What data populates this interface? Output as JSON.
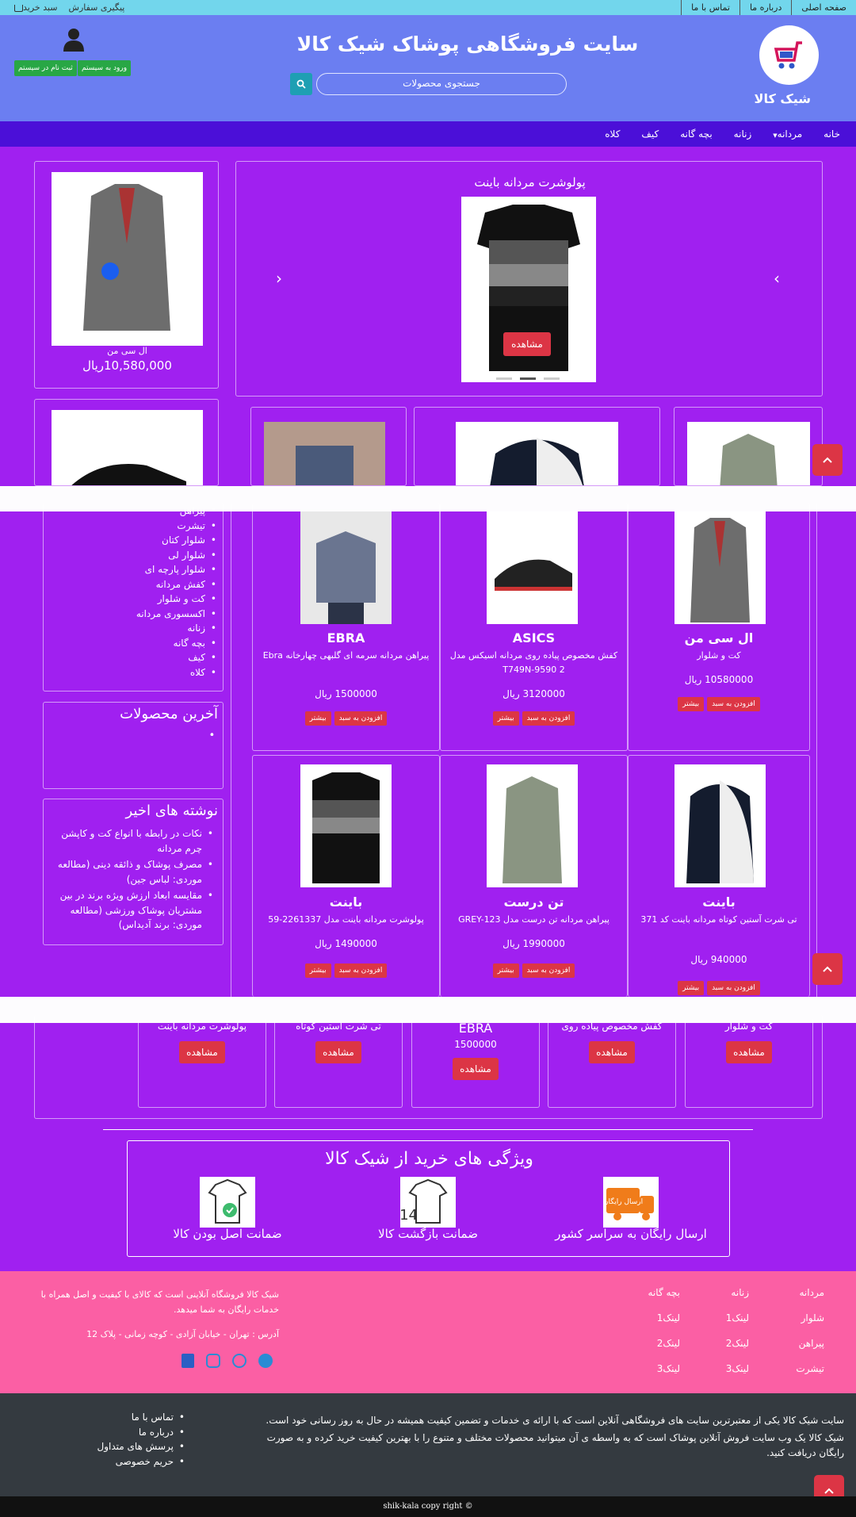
{
  "topbar": {
    "links": [
      "صفحه اصلی",
      "درباره ما",
      "تماس با ما"
    ],
    "track": "پیگیری سفارش",
    "cart": "سبد خرید"
  },
  "header": {
    "logo_text": "شیک کالا",
    "site_title": "سایت فروشگاهی پوشاک شیک کالا",
    "search_placeholder": "جستجوی محصولات",
    "login": "ورود به سیستم",
    "register": "ثبت نام در سیستم"
  },
  "nav": [
    "خانه",
    "مردانه",
    "زنانه",
    "بچه گانه",
    "کیف",
    "کلاه"
  ],
  "slider": {
    "title": "پولوشرت مردانه باینت",
    "button": "مشاهده"
  },
  "featured": {
    "name": "ال سی من",
    "price": "10,580,000ریال"
  },
  "categories": [
    "پیراهن",
    "تیشرت",
    "شلوار کتان",
    "شلوار لی",
    "شلوار پارچه ای",
    "کفش مردانه",
    "کت و شلوار",
    "اکسسوری مردانه",
    "زنانه",
    "بچه گانه",
    "کیف",
    "کلاه"
  ],
  "latest": {
    "title": "آخرین محصولات"
  },
  "posts": {
    "title": "نوشته های اخیر",
    "items": [
      "نکات در رابطه با انواع کت و کاپشن چرم مردانه",
      "مصرف پوشاک و ذائقه دینی (مطالعه موردی: لباس جین)",
      "مقایسه ابعاد ارزش ویژه برند در بین مشتریان پوشاک ورزشی (مطالعه موردی: برند آدیداس)"
    ]
  },
  "products": [
    {
      "brand": "ال سی من",
      "desc": "کت و شلوار",
      "price": "10580000 ریال"
    },
    {
      "brand": "ASICS",
      "desc": "کفش مخصوص پیاده روی مردانه اسیکس مدل T749N-9590 2",
      "price": "3120000 ریال"
    },
    {
      "brand": "EBRA",
      "desc": "پیراهن مردانه سرمه ای گلبهی چهارخانه Ebra",
      "price": "1500000 ریال"
    },
    {
      "brand": "باینت",
      "desc": "تی شرت آستین کوتاه مردانه باینت کد 371",
      "price": "940000 ریال"
    },
    {
      "brand": "تن درست",
      "desc": "پیراهن مردانه تن درست مدل GREY-123",
      "price": "1990000 ریال"
    },
    {
      "brand": "باینت",
      "desc": "پولوشرت مردانه باینت مدل 2261337-59",
      "price": "1490000 ریال"
    }
  ],
  "product_buttons": {
    "add": "افزودن به سبد",
    "more": "بیشتر"
  },
  "bottom_row": [
    {
      "label": "کت و شلوار",
      "button": "مشاهده"
    },
    {
      "label": "کفش مخصوص پیاده روی",
      "button": "مشاهده"
    },
    {
      "label": "EBRA",
      "price": "1500000",
      "button": "مشاهده"
    },
    {
      "label": "تی شرت آستین کوتاه",
      "button": "مشاهده"
    },
    {
      "label": "پولوشرت مردانه باینت",
      "button": "مشاهده"
    }
  ],
  "features": {
    "title": "ویژگی های خرید از شیک کالا",
    "items": [
      "ارسال رایگان به سراسر کشور",
      "ضمانت بازگشت کالا",
      "ضمانت اصل بودن کالا"
    ],
    "badge_text": "ارسال رایگان",
    "return_days": "14"
  },
  "footer_links": {
    "col1": [
      "مردانه",
      "شلوار",
      "پیراهن",
      "تیشرت"
    ],
    "col2": [
      "زنانه",
      "لینک1",
      "لینک2",
      "لینک3"
    ],
    "col3": [
      "بچه گانه",
      "لینک1",
      "لینک2",
      "لینک3"
    ]
  },
  "footer_about": {
    "text": "شیک کالا فروشگاه آنلاینی است که کالای با کیفیت و اصل همراه با خدمات رایگان به شما میدهد.",
    "address": "آدرس : تهران - خیابان آزادی - کوچه زمانی - پلاک 12"
  },
  "footer_dark": {
    "para1": "سایت شیک کالا یکی از معتبرترین سایت های فروشگاهی آنلاین است که با ارائه ی خدمات و تضمین کیفیت همیشه در حال به روز رسانی خود است.",
    "para2": "شیک کالا یک وب سایت فروش آنلاین پوشاک است که به واسطه ی آن میتوانید محصولات مختلف و متنوع را با بهترین کیفیت خرید کرده و به صورت رایگان دریافت کنید.",
    "links": [
      "تماس با ما",
      "درباره ما",
      "پرسش های متداول",
      "حریم خصوصی"
    ]
  },
  "copyright": "© shik-kala copy right",
  "colors": {
    "topbar": "#72d6ec",
    "header": "#6b7ef1",
    "nav": "#4b0fd8",
    "body": "#a020f0",
    "footer_pink": "#fb5fa4",
    "footer_dark": "#343a40",
    "button_red": "#dc3545",
    "button_green": "#28a745"
  }
}
